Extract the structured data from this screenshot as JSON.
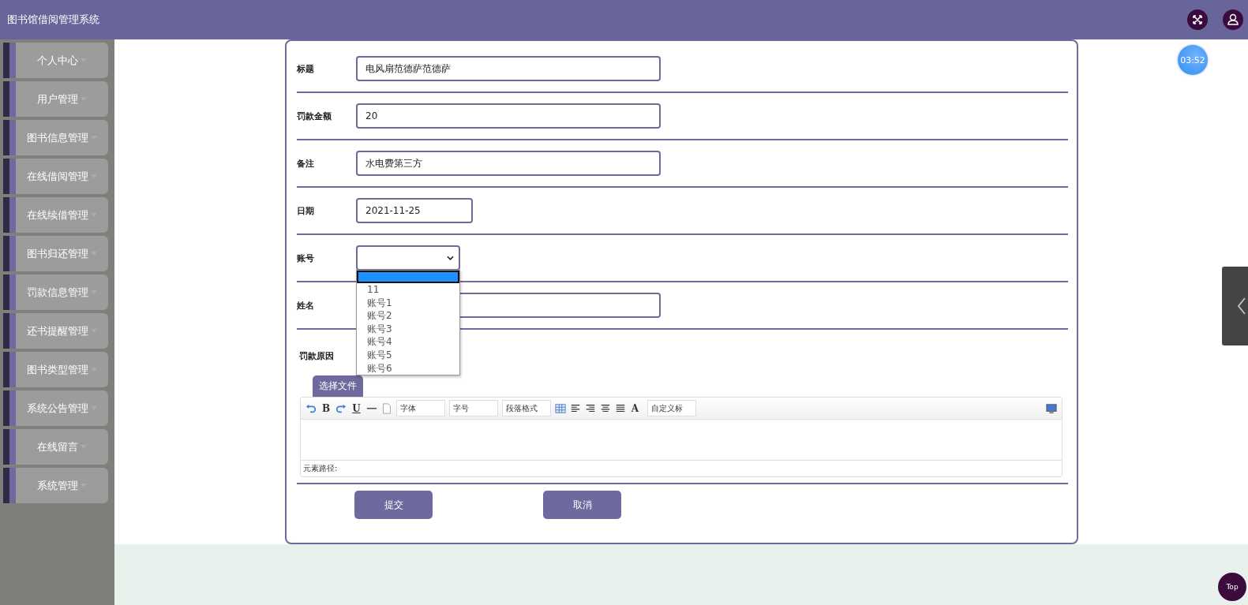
{
  "header": {
    "title": "图书馆借阅管理系统"
  },
  "sidebar": {
    "items": [
      {
        "label": "个人中心"
      },
      {
        "label": "用户管理"
      },
      {
        "label": "图书信息管理"
      },
      {
        "label": "在线借阅管理"
      },
      {
        "label": "在线续借管理"
      },
      {
        "label": "图书归还管理"
      },
      {
        "label": "罚款信息管理"
      },
      {
        "label": "还书提醒管理"
      },
      {
        "label": "图书类型管理"
      },
      {
        "label": "系统公告管理"
      },
      {
        "label": "在线留言"
      },
      {
        "label": "系统管理"
      }
    ]
  },
  "form": {
    "fields": [
      {
        "kind": "text",
        "label": "标题",
        "value": "电风扇范德萨范德萨"
      },
      {
        "kind": "text",
        "label": "罚款金额",
        "value": "20"
      },
      {
        "kind": "text",
        "label": "备注",
        "value": "水电费第三方"
      },
      {
        "kind": "date",
        "label": "日期",
        "value": "2021-11-25"
      },
      {
        "kind": "select",
        "label": "账号",
        "expanded": true,
        "options": [
          {
            "selected": true
          },
          {
            "label": "11",
            "selected": false
          },
          {
            "label": "账号1",
            "selected": false
          },
          {
            "label": "账号2",
            "selected": false
          },
          {
            "label": "账号3",
            "selected": false
          },
          {
            "label": "账号4",
            "selected": false
          },
          {
            "label": "账号5",
            "selected": false
          },
          {
            "label": "账号6",
            "selected": false
          }
        ]
      },
      {
        "kind": "text",
        "label": "姓名"
      }
    ],
    "reason": {
      "label": "罚款原因",
      "upload_button": "选择文件",
      "toolbar": [
        {
          "kind": "undo"
        },
        {
          "kind": "glyph",
          "label": "B"
        },
        {
          "kind": "redo"
        },
        {
          "kind": "underline",
          "label": "U"
        },
        {
          "kind": "hr"
        },
        {
          "kind": "page"
        },
        {
          "kind": "select",
          "label": "字体"
        },
        {
          "kind": "select",
          "label": "字号"
        },
        {
          "kind": "select",
          "label": "段落格式"
        },
        {
          "kind": "table"
        },
        {
          "kind": "alignleft"
        },
        {
          "kind": "alignright"
        },
        {
          "kind": "aligncenter"
        },
        {
          "kind": "justify"
        },
        {
          "kind": "color",
          "label": "A"
        },
        {
          "kind": "select",
          "label": "自定义标"
        },
        {
          "kind": "preview"
        }
      ],
      "path_label": "元素路径:"
    },
    "buttons": [
      {
        "label": "提交"
      },
      {
        "label": "取消"
      }
    ]
  },
  "clock": "03:52",
  "top_button": "Top"
}
